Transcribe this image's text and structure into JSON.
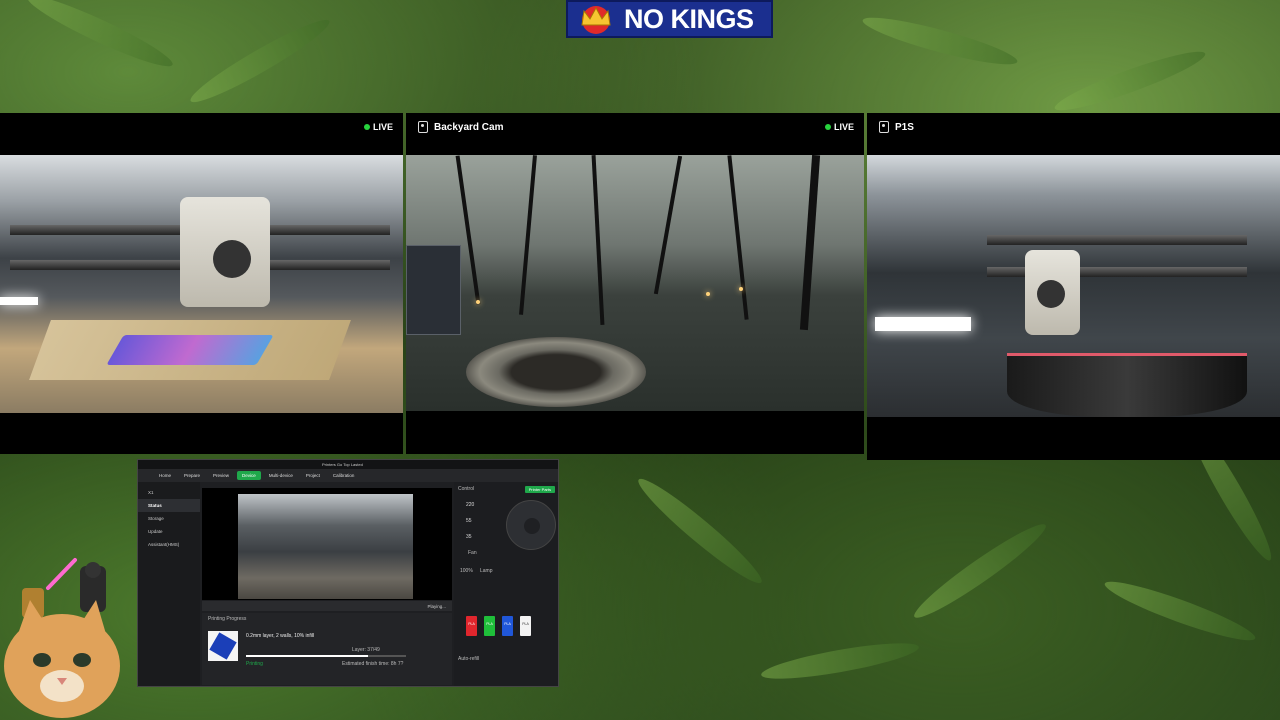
{
  "banner": {
    "text": "NO KINGS"
  },
  "cameras": [
    {
      "title": "",
      "live_label": "LIVE"
    },
    {
      "title": "Backyard Cam",
      "live_label": "LIVE"
    },
    {
      "title": "P1S",
      "live_label": ""
    }
  ],
  "app": {
    "window_title": "Printers Go Top Lasted",
    "tabs": [
      "Home",
      "Prepare",
      "Preview",
      "Device",
      "Multi-device",
      "Project",
      "Calibration"
    ],
    "active_tab": "Device",
    "device_name": "X1",
    "sidebar": [
      "Status",
      "Storage",
      "Update",
      "Assistant(HMS)"
    ],
    "camera_status": "Playing...",
    "printing_progress_label": "Printing Progress",
    "job_name": "0.2mm layer, 2 walls, 10% infill",
    "layer_text": "Layer: 37/49",
    "state_text": "Printing",
    "progress_percent": 76,
    "estimated_text": "Estimated finish time: 8h 7?",
    "control_label": "Control",
    "printer_parts_button": "Printer Parts",
    "temps": [
      "220",
      "55",
      "35"
    ],
    "fan_label": "Fan",
    "speed_label": "100%",
    "lamp_label": "Lamp",
    "auto_refill_label": "Auto-refill",
    "spools": [
      {
        "label": "PLA",
        "color": "#e0262d"
      },
      {
        "label": "PLA",
        "color": "#1fbf3a"
      },
      {
        "label": "PLA",
        "color": "#2057d9"
      },
      {
        "label": "PLA",
        "color": "#f3f3f3"
      }
    ]
  }
}
